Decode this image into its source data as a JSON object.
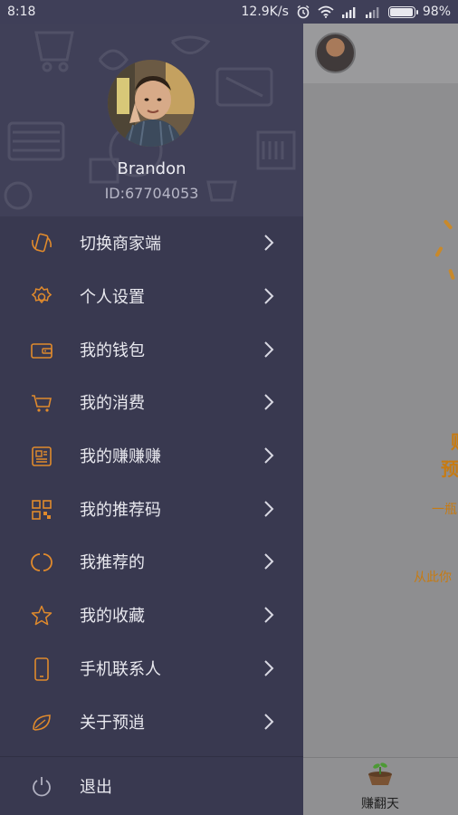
{
  "status_bar": {
    "time": "8:18",
    "network_speed": "12.9K/s",
    "battery": "98%",
    "battery_level": 0.98
  },
  "profile": {
    "username": "Brandon",
    "user_id": "ID:67704053"
  },
  "menu": {
    "items": [
      {
        "label": "切换商家端",
        "icon": "switch-device-icon"
      },
      {
        "label": "个人设置",
        "icon": "gear-icon"
      },
      {
        "label": "我的钱包",
        "icon": "wallet-icon"
      },
      {
        "label": "我的消费",
        "icon": "cart-icon"
      },
      {
        "label": "我的赚赚赚",
        "icon": "document-icon"
      },
      {
        "label": "我的推荐码",
        "icon": "qr-code-icon"
      },
      {
        "label": "我推荐的",
        "icon": "circle-refresh-icon"
      },
      {
        "label": "我的收藏",
        "icon": "star-icon"
      },
      {
        "label": "手机联系人",
        "icon": "phone-icon"
      },
      {
        "label": "关于预逍",
        "icon": "leaf-icon"
      }
    ],
    "logout": {
      "label": "退出",
      "icon": "power-icon"
    }
  },
  "background_page": {
    "text_lines": [
      "财",
      "预逍",
      "一瓶",
      "从此你"
    ],
    "tab_label": "赚翻天"
  },
  "colors": {
    "drawer_bg": "#393950",
    "accent_orange": "#e08a2c",
    "text_light": "#e9e9ef"
  }
}
